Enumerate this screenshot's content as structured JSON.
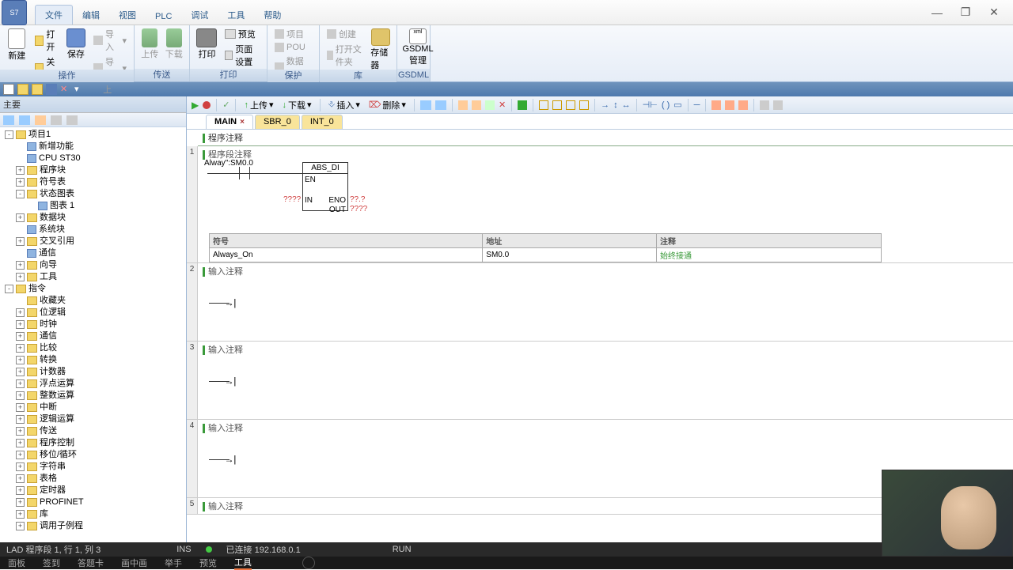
{
  "menus": [
    "文件",
    "编辑",
    "视图",
    "PLC",
    "调试",
    "工具",
    "帮助"
  ],
  "ribbon": {
    "op": {
      "title": "操作",
      "new": "新建",
      "open": "打开",
      "close": "关闭",
      "save": "保存",
      "import": "导入",
      "export": "导出",
      "prev": "上一个"
    },
    "trans": {
      "title": "传送",
      "upload": "上传",
      "download": "下载"
    },
    "print": {
      "title": "打印",
      "print": "打印",
      "preview": "预览",
      "setup": "页面设置"
    },
    "protect": {
      "title": "保护",
      "project": "项目",
      "pou": "POU",
      "datapage": "数据页"
    },
    "lib": {
      "title": "库",
      "create": "创建",
      "openmem": "打开文件夹",
      "storage": "存储器"
    },
    "gsdml": {
      "title": "GSDML",
      "t1": "GSDML",
      "t2": "管理"
    }
  },
  "leftPanel": {
    "title": "主要"
  },
  "tree": [
    {
      "d": 0,
      "e": "-",
      "i": "f",
      "t": "项目1"
    },
    {
      "d": 1,
      "e": "",
      "i": "n",
      "t": "新增功能"
    },
    {
      "d": 1,
      "e": "",
      "i": "c",
      "t": "CPU ST30"
    },
    {
      "d": 1,
      "e": "+",
      "i": "f",
      "t": "程序块"
    },
    {
      "d": 1,
      "e": "+",
      "i": "f",
      "t": "符号表"
    },
    {
      "d": 1,
      "e": "-",
      "i": "f",
      "t": "状态图表"
    },
    {
      "d": 2,
      "e": "",
      "i": "c",
      "t": "图表 1"
    },
    {
      "d": 1,
      "e": "+",
      "i": "f",
      "t": "数据块"
    },
    {
      "d": 1,
      "e": "",
      "i": "c",
      "t": "系统块"
    },
    {
      "d": 1,
      "e": "+",
      "i": "f",
      "t": "交叉引用"
    },
    {
      "d": 1,
      "e": "",
      "i": "c",
      "t": "通信"
    },
    {
      "d": 1,
      "e": "+",
      "i": "f",
      "t": "向导"
    },
    {
      "d": 1,
      "e": "+",
      "i": "f",
      "t": "工具"
    },
    {
      "d": 0,
      "e": "-",
      "i": "f",
      "t": "指令"
    },
    {
      "d": 1,
      "e": "",
      "i": "f",
      "t": "收藏夹"
    },
    {
      "d": 1,
      "e": "+",
      "i": "f",
      "t": "位逻辑"
    },
    {
      "d": 1,
      "e": "+",
      "i": "f",
      "t": "时钟"
    },
    {
      "d": 1,
      "e": "+",
      "i": "f",
      "t": "通信"
    },
    {
      "d": 1,
      "e": "+",
      "i": "f",
      "t": "比较"
    },
    {
      "d": 1,
      "e": "+",
      "i": "f",
      "t": "转换"
    },
    {
      "d": 1,
      "e": "+",
      "i": "f",
      "t": "计数器"
    },
    {
      "d": 1,
      "e": "+",
      "i": "f",
      "t": "浮点运算"
    },
    {
      "d": 1,
      "e": "+",
      "i": "f",
      "t": "整数运算"
    },
    {
      "d": 1,
      "e": "+",
      "i": "f",
      "t": "中断"
    },
    {
      "d": 1,
      "e": "+",
      "i": "f",
      "t": "逻辑运算"
    },
    {
      "d": 1,
      "e": "+",
      "i": "f",
      "t": "传送"
    },
    {
      "d": 1,
      "e": "+",
      "i": "f",
      "t": "程序控制"
    },
    {
      "d": 1,
      "e": "+",
      "i": "f",
      "t": "移位/循环"
    },
    {
      "d": 1,
      "e": "+",
      "i": "f",
      "t": "字符串"
    },
    {
      "d": 1,
      "e": "+",
      "i": "f",
      "t": "表格"
    },
    {
      "d": 1,
      "e": "+",
      "i": "f",
      "t": "定时器"
    },
    {
      "d": 1,
      "e": "+",
      "i": "f",
      "t": "PROFINET"
    },
    {
      "d": 1,
      "e": "+",
      "i": "f",
      "t": "库"
    },
    {
      "d": 1,
      "e": "+",
      "i": "f",
      "t": "调用子例程"
    }
  ],
  "editorTb": {
    "upload": "上传",
    "download": "下载",
    "insert": "插入",
    "delete": "删除"
  },
  "tabs": [
    {
      "label": "MAIN",
      "active": true,
      "close": true
    },
    {
      "label": "SBR_0",
      "yellow": true
    },
    {
      "label": "INT_0",
      "yellow": true
    }
  ],
  "progComment": "程序注释",
  "networks": [
    {
      "num": "1",
      "title": "程序段注释",
      "hasLogic": true
    },
    {
      "num": "2",
      "title": "输入注释"
    },
    {
      "num": "3",
      "title": "输入注释"
    },
    {
      "num": "4",
      "title": "输入注释"
    },
    {
      "num": "5",
      "title": "输入注释"
    }
  ],
  "ladder1": {
    "contactLabel": "Alway\":SM0.0",
    "block": "ABS_DI",
    "en": "EN",
    "in": "IN",
    "eno": "ENO",
    "out": "OUT",
    "q": "????",
    "q2": "??.?"
  },
  "varTable": {
    "headers": [
      "符号",
      "地址",
      "注释"
    ],
    "row": [
      "Always_On",
      "SM0.0",
      "始终接通"
    ]
  },
  "status": {
    "left": "LAD 程序段 1, 行 1, 列 3",
    "ins": "INS",
    "conn": "已连接 192.168.0.1",
    "run": "RUN"
  },
  "taskbar": [
    "面板",
    "签到",
    "答题卡",
    "画中画",
    "举手",
    "预览",
    "工具"
  ]
}
